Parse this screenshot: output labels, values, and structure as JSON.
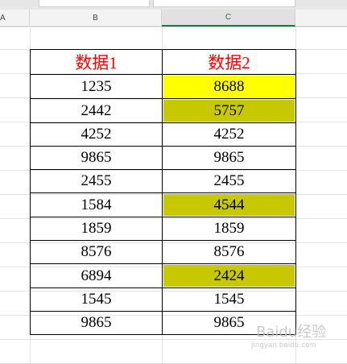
{
  "columns": {
    "a": "A",
    "b": "B",
    "c": "C"
  },
  "table": {
    "headers": [
      "数据1",
      "数据2"
    ],
    "rows": [
      {
        "b": "1235",
        "c": "8688",
        "fill": "bright"
      },
      {
        "b": "2442",
        "c": "5757",
        "fill": "olive"
      },
      {
        "b": "4252",
        "c": "4252",
        "fill": ""
      },
      {
        "b": "9865",
        "c": "9865",
        "fill": ""
      },
      {
        "b": "2455",
        "c": "2455",
        "fill": ""
      },
      {
        "b": "1584",
        "c": "4544",
        "fill": "olive"
      },
      {
        "b": "1859",
        "c": "1859",
        "fill": ""
      },
      {
        "b": "8576",
        "c": "8576",
        "fill": ""
      },
      {
        "b": "6894",
        "c": "2424",
        "fill": "olive"
      },
      {
        "b": "1545",
        "c": "1545",
        "fill": ""
      },
      {
        "b": "9865",
        "c": "9865",
        "fill": ""
      }
    ]
  },
  "colors": {
    "header_text": "#ff0000",
    "fill_bright": "#ffff00",
    "fill_olive": "#c8c800",
    "selected_col": "#217346"
  },
  "watermark": {
    "text": "Baidu经验",
    "sub": "jingyan.baidu.com"
  }
}
